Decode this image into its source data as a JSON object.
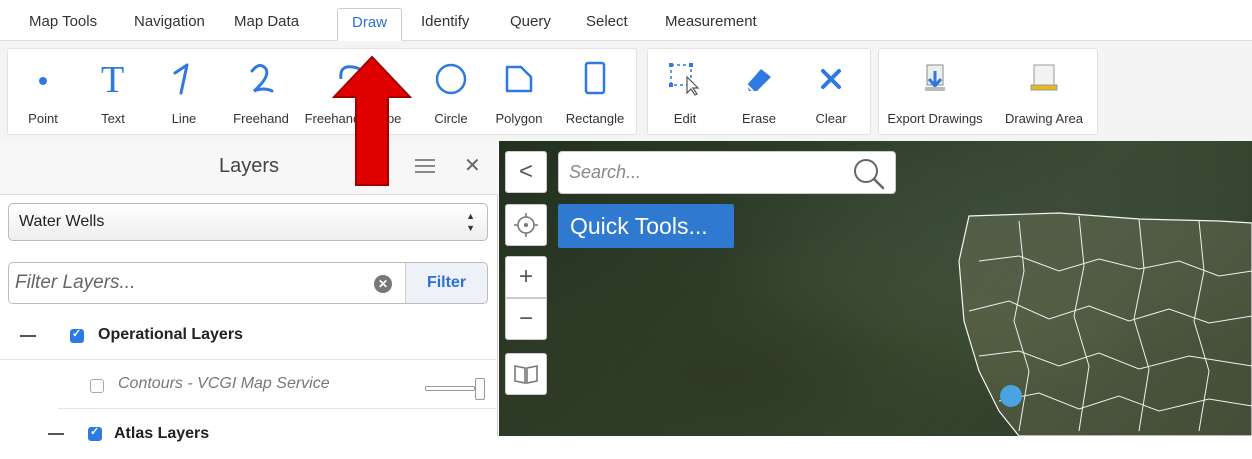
{
  "tabs": [
    {
      "label": "Map Tools"
    },
    {
      "label": "Navigation"
    },
    {
      "label": "Map Data"
    },
    {
      "label": "Draw"
    },
    {
      "label": "Identify"
    },
    {
      "label": "Query"
    },
    {
      "label": "Select"
    },
    {
      "label": "Measurement"
    }
  ],
  "active_tab": "Draw",
  "ribbon": {
    "draw_tools": [
      {
        "label": "Point",
        "icon": "point-icon"
      },
      {
        "label": "Text",
        "icon": "text-icon"
      },
      {
        "label": "Line",
        "icon": "line-icon"
      },
      {
        "label": "Freehand",
        "icon": "freehand-icon"
      },
      {
        "label": "Freehand Shape",
        "icon": "freehand-shape-icon"
      },
      {
        "label": "Circle",
        "icon": "circle-icon"
      },
      {
        "label": "Polygon",
        "icon": "polygon-icon"
      },
      {
        "label": "Rectangle",
        "icon": "rectangle-icon"
      }
    ],
    "edit_tools": [
      {
        "label": "Edit",
        "icon": "edit-select-icon"
      },
      {
        "label": "Erase",
        "icon": "eraser-icon"
      },
      {
        "label": "Clear",
        "icon": "clear-x-icon"
      }
    ],
    "export_tools": [
      {
        "label": "Export Drawings",
        "icon": "export-icon"
      },
      {
        "label": "Drawing Area",
        "icon": "drawing-area-icon"
      }
    ]
  },
  "layers_panel": {
    "title": "Layers",
    "select_value": "Water Wells",
    "filter_placeholder": "Filter Layers...",
    "filter_button": "Filter",
    "rows": [
      {
        "label": "Operational Layers",
        "checked": true
      },
      {
        "label": "Contours - VCGI Map Service",
        "checked": false
      },
      {
        "label": "Atlas Layers",
        "checked": true
      }
    ]
  },
  "map": {
    "search_placeholder": "Search...",
    "quick_tools_label": "Quick Tools...",
    "zoom_in": "+",
    "zoom_out": "−",
    "back": "<"
  },
  "colors": {
    "accent": "#2f6fd6",
    "quick_tools_bg": "#2f7ad0",
    "annotation_arrow": "#e00000",
    "location_dot": "#49a4e0"
  }
}
